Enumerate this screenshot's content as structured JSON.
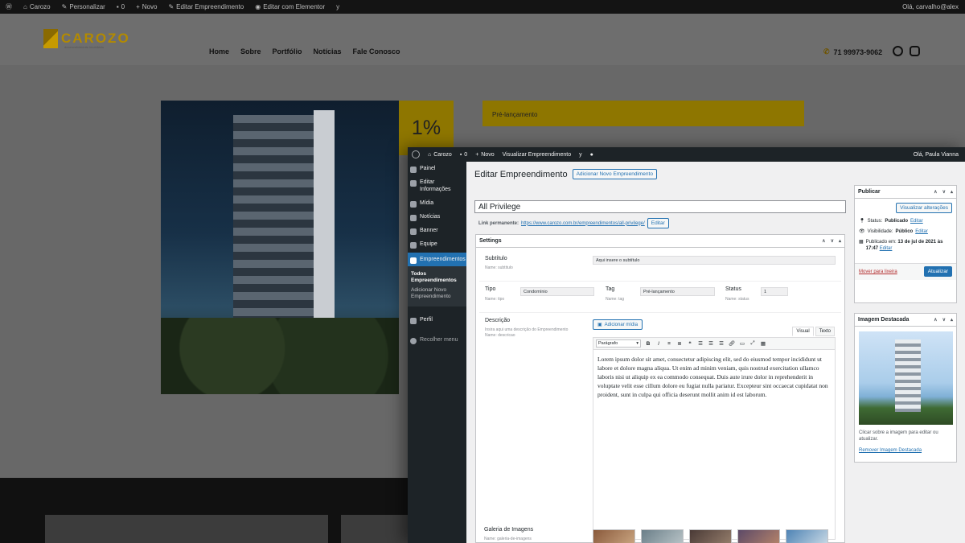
{
  "bg_adminbar": {
    "site": "Carozo",
    "customize": "Personalizar",
    "comments": "0",
    "new": "Novo",
    "edit": "Editar Empreendimento",
    "elementor": "Editar com Elementor",
    "greeting": "Olá, carvalho@alex"
  },
  "site": {
    "logo_text": "CAROZO",
    "logo_sub": "desenvolvimento imobiliário",
    "nav": [
      "Home",
      "Sobre",
      "Portfólio",
      "Notícias",
      "Fale Conosco"
    ],
    "phone": "71 99973-9062",
    "pct": "1%",
    "status_band": "Pré-lançamento"
  },
  "admin": {
    "bar": {
      "site": "Carozo",
      "comments": "0",
      "new": "Novo",
      "view": "Visualizar Empreendimento",
      "greeting": "Olá, Paula Vianna"
    },
    "menu": [
      "Painel",
      "Editar Informações",
      "Mídia",
      "Notícias",
      "Banner",
      "Equipe",
      "Empreendimentos",
      "Perfil",
      "Recolher menu"
    ],
    "submenu": [
      "Todos Empreendimentos",
      "Adicionar Novo Empreendimento"
    ],
    "page_title": "Editar Empreendimento",
    "add_new": "Adicionar Novo Empreendimento",
    "post_title": "All Privilege",
    "permalink_label": "Link permanente:",
    "permalink_url": "https://www.carozo.com.br/empreendimentos/all-privilege/",
    "permalink_edit": "Editar",
    "settings": {
      "title": "Settings",
      "subtitulo_label": "Subtítulo",
      "subtitulo_name": "Name: subtitulo",
      "subtitulo_value": "Aqui insere o subtítulo",
      "tipo_label": "Tipo",
      "tipo_name": "Name: tipo",
      "tipo_value": "Condomínio",
      "tag_label": "Tag",
      "tag_name": "Name: tag",
      "tag_value": "Pré-lançamento",
      "status_label": "Status",
      "status_name": "Name: status",
      "status_value": "1",
      "descricao_label": "Descrição",
      "descricao_help": "Insira aqui uma descrição do Empreendimento",
      "descricao_name": "Name: descricao",
      "add_media": "Adicionar mídia",
      "tab_visual": "Visual",
      "tab_text": "Texto",
      "format": "Parágrafo",
      "body": "Lorem ipsum dolor sit amet, consectetur adipiscing elit, sed do eiusmod tempor incididunt ut labore et dolore magna aliqua. Ut enim ad minim veniam, quis nostrud exercitation ullamco laboris nisi ut aliquip ex ea commodo consequat. Duis aute irure dolor in reprehenderit in voluptate velit esse cillum dolore eu fugiat nulla pariatur. Excepteur sint occaecat cupidatat non proident, sunt in culpa qui officia deserunt mollit anim id est laborum.",
      "gallery_label": "Galeria de Imagens",
      "gallery_name": "Name: galeria-de-imagens"
    },
    "publish": {
      "title": "Publicar",
      "preview": "Visualizar alterações",
      "status_label": "Status:",
      "status_value": "Publicado",
      "visibility_label": "Visibilidade:",
      "visibility_value": "Público",
      "edit": "Editar",
      "published_label": "Publicado em:",
      "published_value": "13 de jul de 2021 às 17:47",
      "trash": "Mover para lixeira",
      "update": "Atualizar"
    },
    "featured": {
      "title": "Imagem Destacada",
      "help": "Clicar sobre a imagem para editar ou atualizar.",
      "remove": "Remover Imagem Destacada"
    }
  }
}
